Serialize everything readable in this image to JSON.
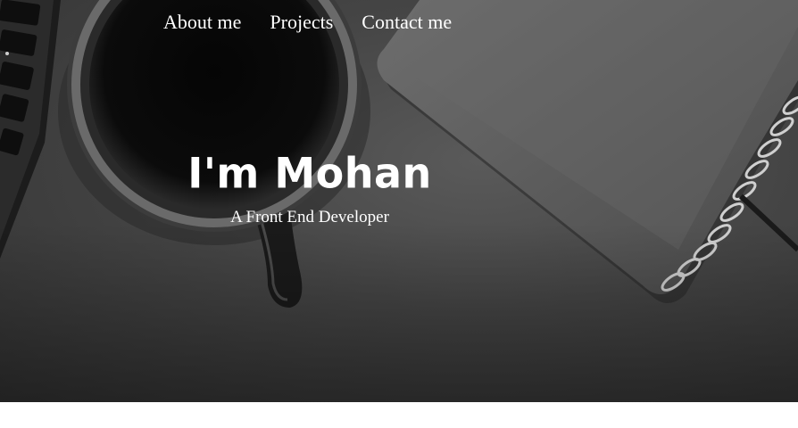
{
  "nav": {
    "items": [
      {
        "label": "About me"
      },
      {
        "label": "Projects"
      },
      {
        "label": "Contact me"
      }
    ]
  },
  "hero": {
    "title": "I'm Mohan",
    "subtitle": "A Front End Developer",
    "background": "coffee-cup-and-notebook-photo"
  },
  "colors": {
    "text": "#ffffff",
    "page_background": "#ffffff",
    "hero_tint": "#454545"
  }
}
